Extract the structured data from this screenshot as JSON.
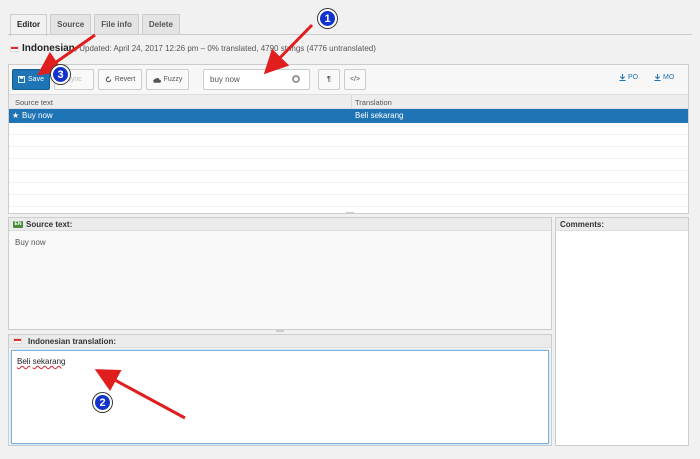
{
  "tabs": [
    "Editor",
    "Source",
    "File info",
    "Delete"
  ],
  "info": {
    "language": "Indonesian",
    "details": ", Updated: April 24, 2017 12:26 pm – 0% translated, 4790 strings (4776 untranslated)"
  },
  "toolbar": {
    "save": "Save",
    "sync": "Sync",
    "revert": "Revert",
    "fuzzy": "Fuzzy",
    "search_value": "buy now",
    "download_po": "PO",
    "download_mo": "MO"
  },
  "grid": {
    "col_source": "Source text",
    "col_translation": "Translation",
    "rows": [
      {
        "source": "Buy now",
        "translation": "Beli sekarang"
      }
    ]
  },
  "source_panel": {
    "label": "Source text:",
    "badge": "EN",
    "text": "Buy now"
  },
  "translation_panel": {
    "label": "Indonesian translation:",
    "word1": "Beli",
    "word2": "sekarang"
  },
  "comments_panel": {
    "label": "Comments:"
  },
  "annotations": [
    "1",
    "2",
    "3"
  ],
  "colors": {
    "accent": "#1f74b6",
    "arrow": "#e01e1e",
    "marker": "#1133cc"
  }
}
